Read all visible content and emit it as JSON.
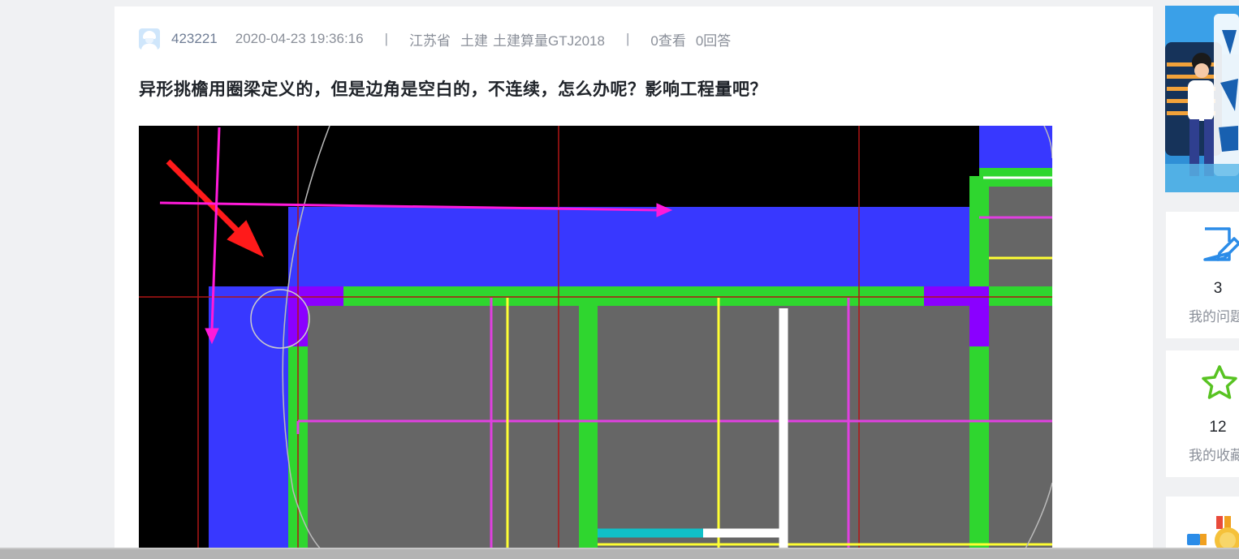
{
  "post": {
    "user": "423221",
    "date": "2020-04-23 19:36:16",
    "separator": "|",
    "region": "江苏省",
    "category": "土建",
    "software": "土建算量GTJ2018",
    "views": "0查看",
    "answers": "0回答",
    "title": "异形挑檐用圈梁定义的，但是边角是空白的，不连续，怎么办呢？影响工程量吧？"
  },
  "sidebar": {
    "my_questions_count": "3",
    "my_questions_label": "我的问题",
    "my_favorites_count": "12",
    "my_favorites_label": "我的收藏"
  },
  "colors": {
    "cad_background": "#000000",
    "beam_blue": "#3838ff",
    "wall_green": "#2fd62f",
    "slab_gray": "#666666",
    "axis_red": "#b01515",
    "line_magenta": "#e040e0",
    "line_yellow": "#ffff33",
    "arrow_red": "#ff1a1a",
    "arrow_magenta": "#ff1ad9",
    "corner_purple": "#8a00ff",
    "banner_blue": "#2f8fd6"
  },
  "icons": {
    "question_icon": "edit-note-icon",
    "favorite_icon": "star-icon",
    "medal_icon": "medal-icon",
    "avatar_icon": "worker-helmet-avatar-icon"
  }
}
